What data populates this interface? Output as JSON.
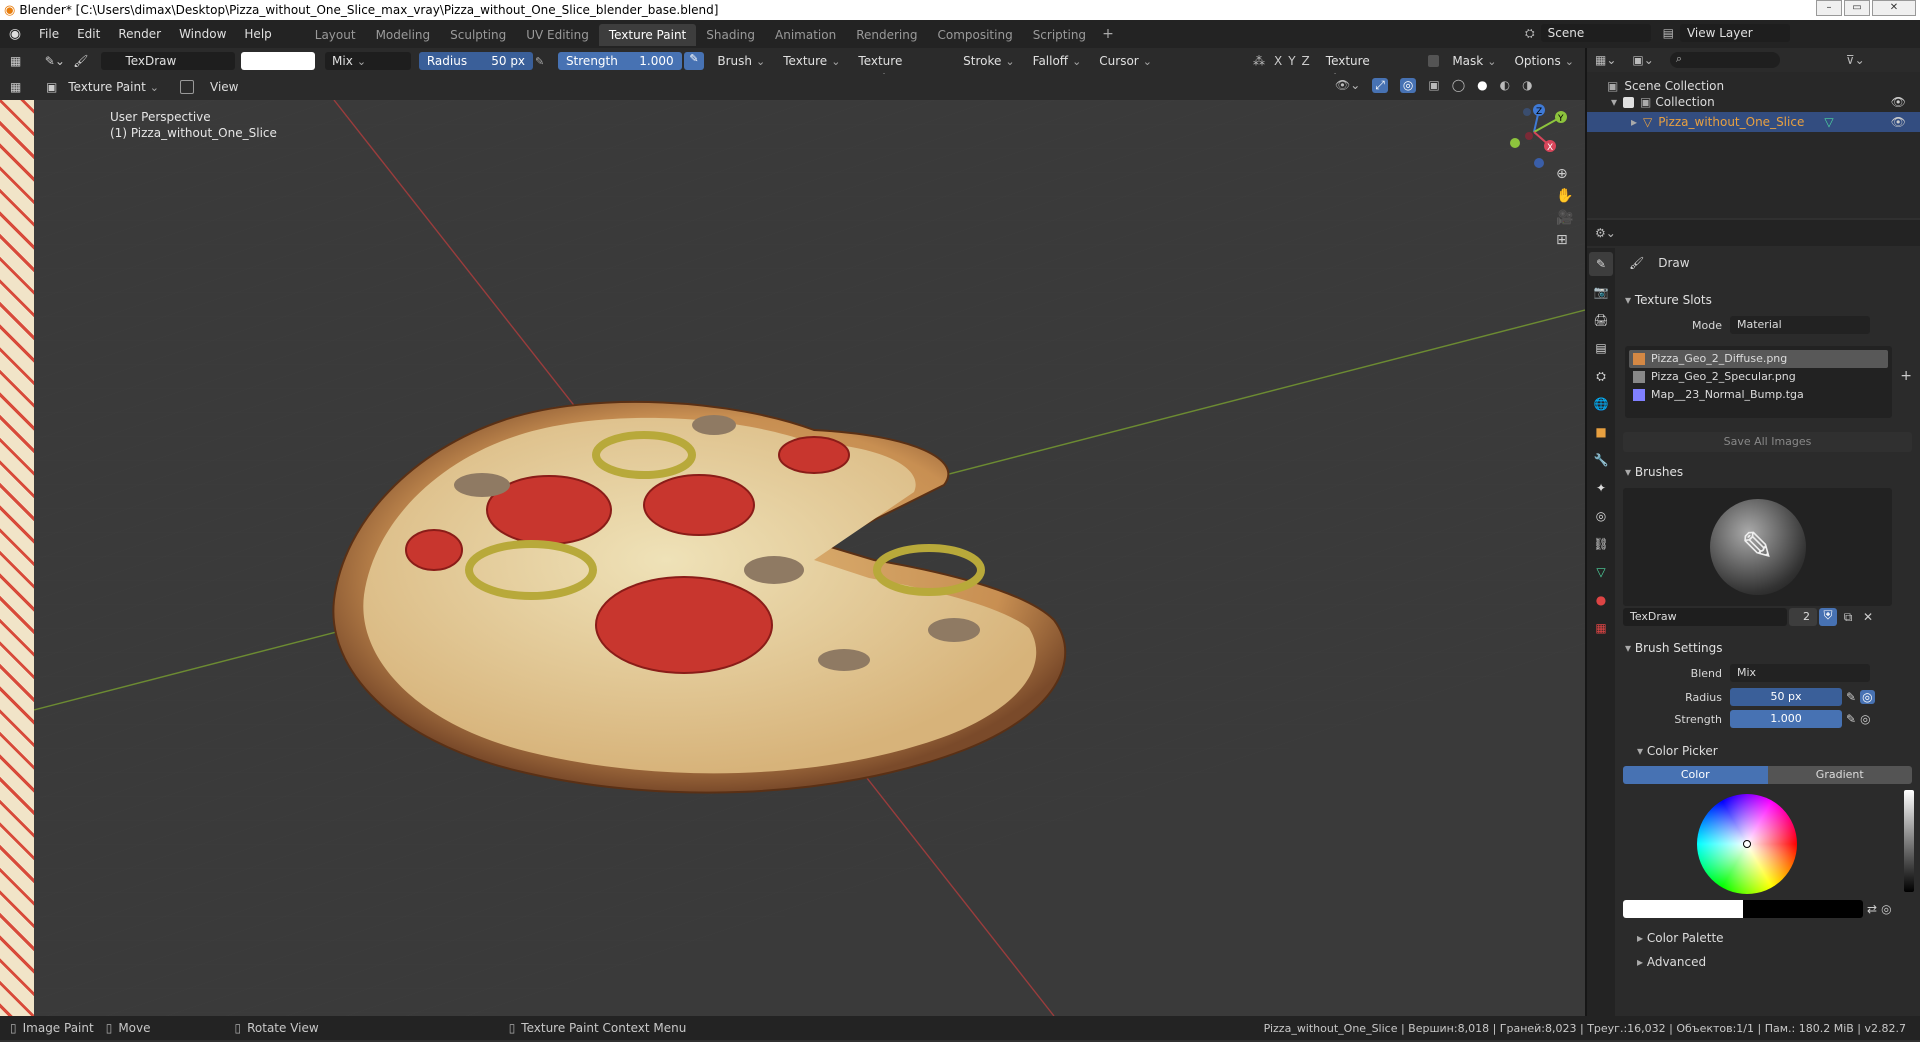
{
  "window": {
    "title": "Blender* [C:\\Users\\dimax\\Desktop\\Pizza_without_One_Slice_max_vray\\Pizza_without_One_Slice_blender_base.blend]"
  },
  "menu": [
    "File",
    "Edit",
    "Render",
    "Window",
    "Help"
  ],
  "workspaces": [
    "Layout",
    "Modeling",
    "Sculpting",
    "UV Editing",
    "Texture Paint",
    "Shading",
    "Animation",
    "Rendering",
    "Compositing",
    "Scripting"
  ],
  "active_workspace": "Texture Paint",
  "scene": {
    "name": "Scene",
    "view_layer": "View Layer"
  },
  "tool_header": {
    "brush_name": "TexDraw",
    "blend": "Mix",
    "radius_label": "Radius",
    "radius_value": "50 px",
    "strength_label": "Strength",
    "strength_value": "1.000",
    "menus": [
      "Brush",
      "Texture",
      "Texture Mask",
      "Stroke",
      "Falloff",
      "Cursor"
    ],
    "axis": [
      "X",
      "Y",
      "Z"
    ],
    "texture_slots": "Texture Slots",
    "mask": "Mask",
    "options": "Options"
  },
  "mode_header": {
    "mode": "Texture Paint",
    "view": "View"
  },
  "viewport": {
    "perspective": "User Perspective",
    "object": "(1) Pizza_without_One_Slice"
  },
  "outliner": {
    "scene_collection": "Scene Collection",
    "collection": "Collection",
    "object": "Pizza_without_One_Slice"
  },
  "properties": {
    "tool_name": "Draw",
    "texture_slots": {
      "title": "Texture Slots",
      "mode_label": "Mode",
      "mode_value": "Material",
      "images": [
        "Pizza_Geo_2_Diffuse.png",
        "Pizza_Geo_2_Specular.png",
        "Map__23_Normal_Bump.tga"
      ],
      "save_all": "Save All Images"
    },
    "brushes": {
      "title": "Brushes",
      "name": "TexDraw",
      "users": "2"
    },
    "brush_settings": {
      "title": "Brush Settings",
      "blend_label": "Blend",
      "blend_value": "Mix",
      "radius_label": "Radius",
      "radius_value": "50 px",
      "strength_label": "Strength",
      "strength_value": "1.000"
    },
    "color_picker": {
      "title": "Color Picker",
      "tab_color": "Color",
      "tab_gradient": "Gradient"
    },
    "color_palette": "Color Palette",
    "advanced": "Advanced"
  },
  "statusbar": {
    "items": [
      "Image Paint",
      "Move",
      "Rotate View",
      "Texture Paint Context Menu"
    ],
    "stats": "Pizza_without_One_Slice | Вершин:8,018 | Граней:8,023 | Треуг.:16,032 | Объектов:1/1 | Пам.: 180.2 MiB | v2.82.7"
  },
  "colors": {
    "accent": "#4772b3",
    "header": "#2b2b2b",
    "viewport": "#3a3a3a",
    "topbar": "#232323"
  }
}
